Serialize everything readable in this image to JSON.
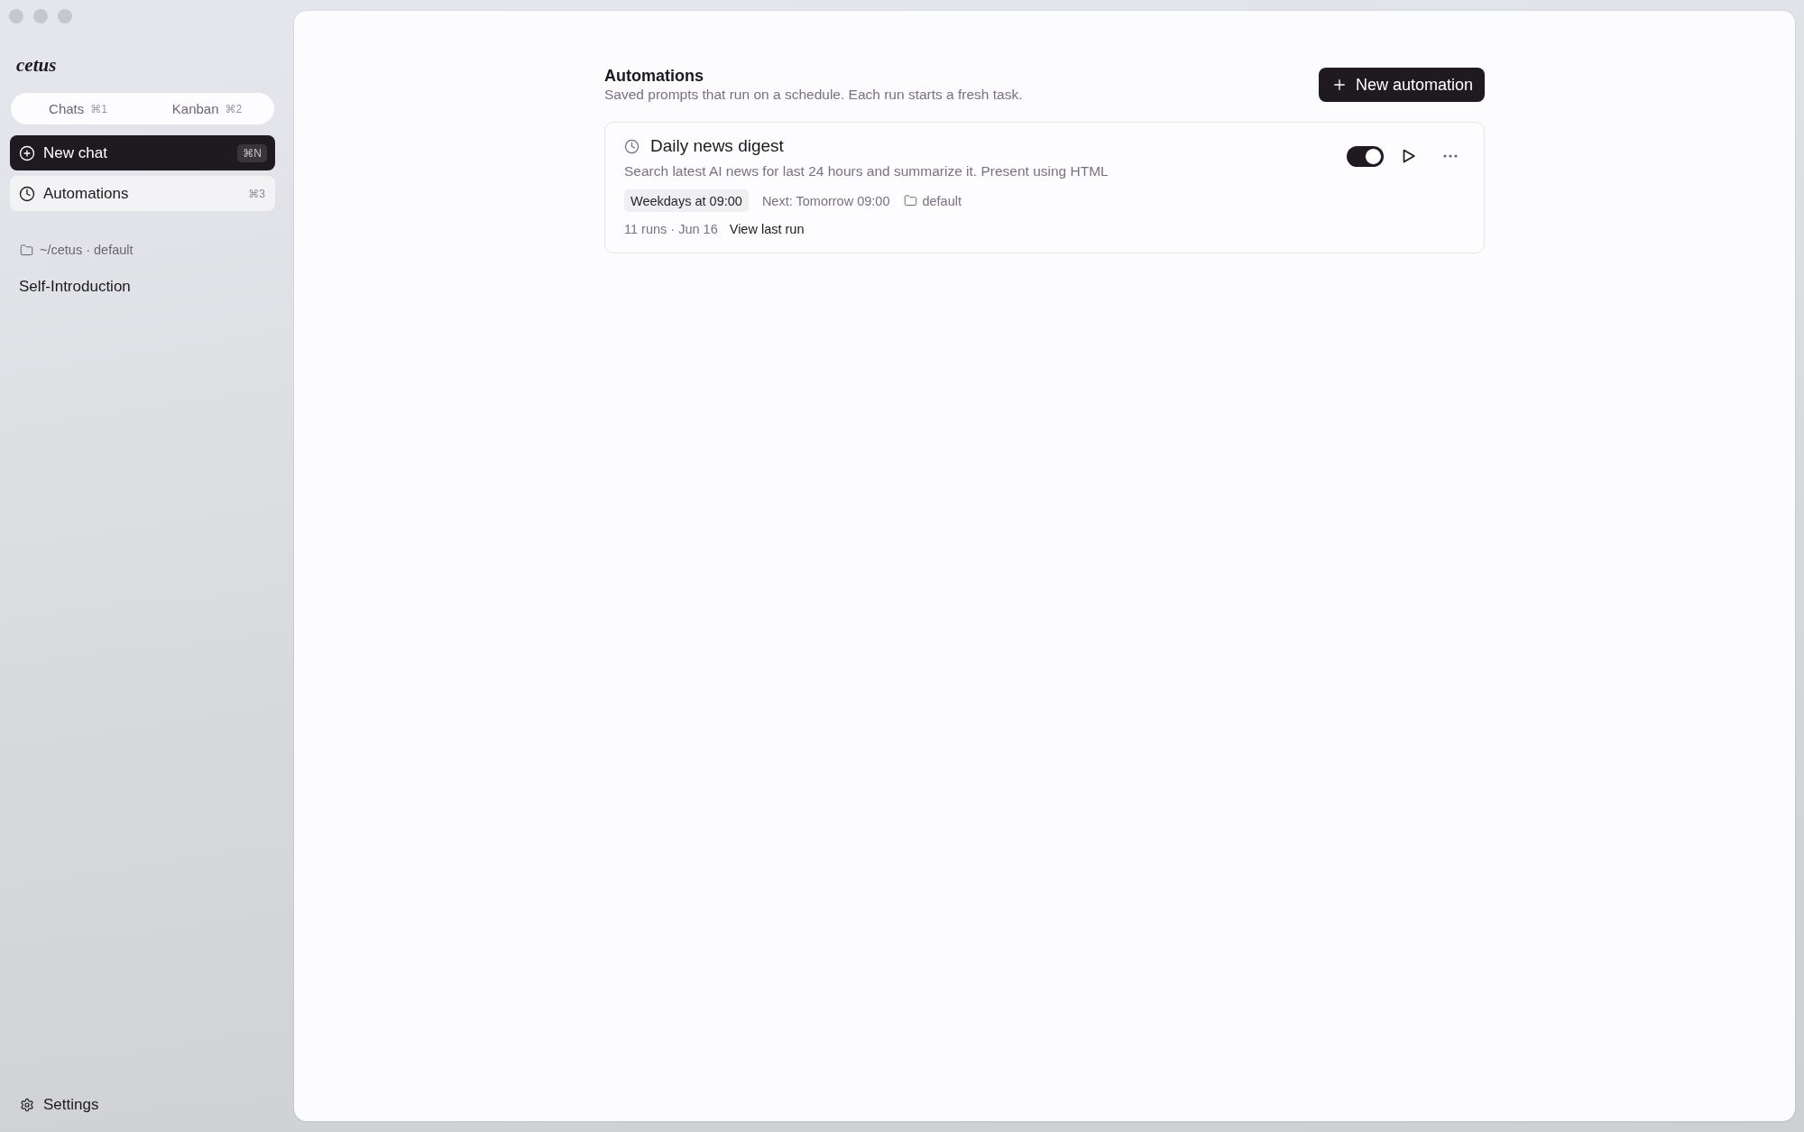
{
  "sidebar": {
    "logo": "cetus",
    "tabs": [
      {
        "label": "Chats",
        "shortcut": "⌘1",
        "selected": false
      },
      {
        "label": "Kanban",
        "shortcut": "⌘2",
        "selected": false
      }
    ],
    "new_chat": {
      "label": "New chat",
      "shortcut": "⌘N"
    },
    "nav": [
      {
        "label": "Automations",
        "shortcut": "⌘3",
        "selected": true
      }
    ],
    "project": "~/cetus · default",
    "chats": [
      {
        "title": "Self-Introduction",
        "selected": false
      }
    ],
    "settings": "Settings"
  },
  "main": {
    "title": "Automations",
    "subtitle": "Saved prompts that run on a schedule. Each run starts a fresh task.",
    "new_button": "New automation",
    "automations": [
      {
        "name": "Daily news digest",
        "prompt": "Search latest AI news for last 24 hours and summarize it. Present using HTML",
        "schedule": "Weekdays at 09:00",
        "next_run": "Next: Tomorrow 09:00",
        "folder": "default",
        "runs": "11 runs · Jun 16",
        "last_run_link": "View last run",
        "on": true
      }
    ]
  }
}
